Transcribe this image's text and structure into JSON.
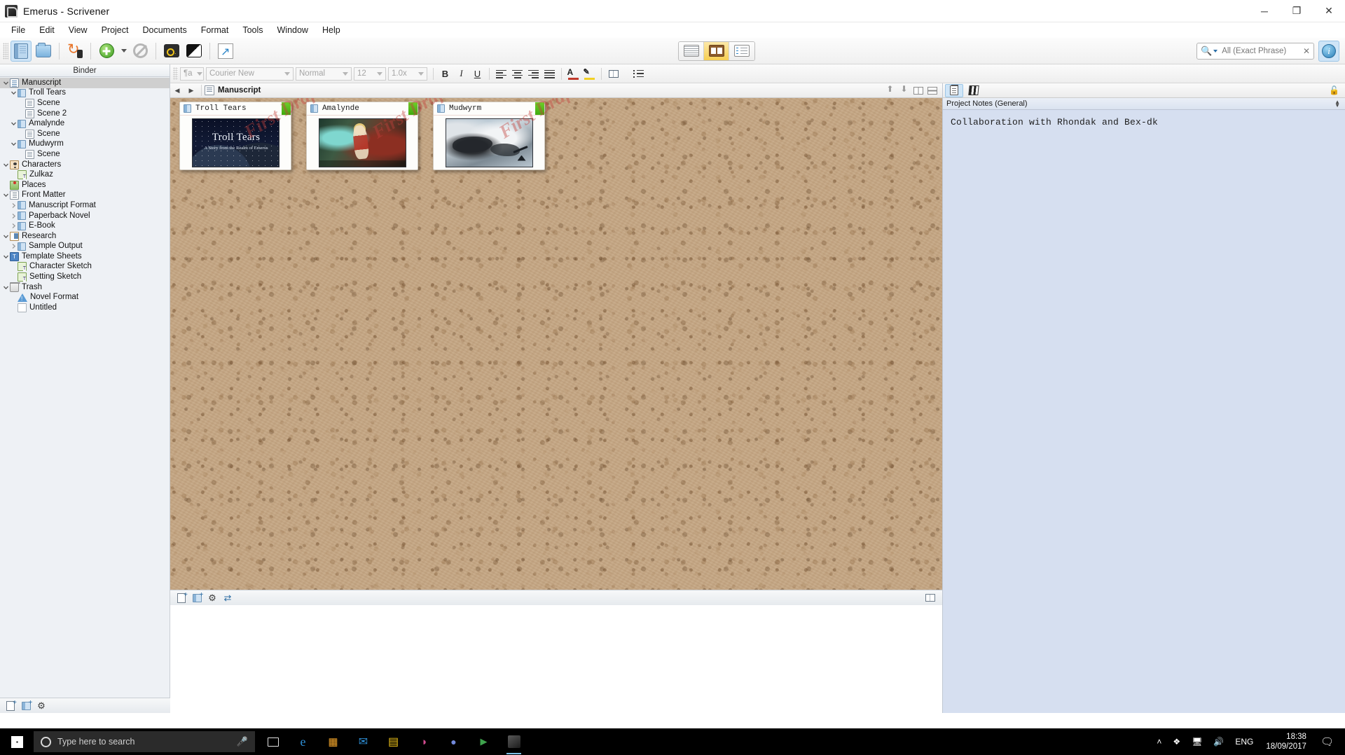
{
  "window": {
    "title": "Emerus - Scrivener",
    "app_icon": "scrivener-icon",
    "minimize": "─",
    "maximize": "❐",
    "close": "✕"
  },
  "menubar": {
    "items": [
      "File",
      "Edit",
      "View",
      "Project",
      "Documents",
      "Format",
      "Tools",
      "Window",
      "Help"
    ]
  },
  "toolbar": {
    "buttons": [
      {
        "name": "binder-toggle",
        "tip": "Binder",
        "active": true
      },
      {
        "name": "collections-toggle",
        "tip": "Collections",
        "active": false
      },
      {
        "name": "sync-mobile",
        "tip": "Sync with Mobile Devices",
        "active": false
      },
      {
        "name": "add-new",
        "tip": "Add",
        "active": false
      },
      {
        "name": "no-editing",
        "tip": "Lock in Place",
        "active": false
      },
      {
        "name": "keywords",
        "tip": "Keywords",
        "active": false
      },
      {
        "name": "split-screen",
        "tip": "Split Screen",
        "active": false
      },
      {
        "name": "compile",
        "tip": "Compile",
        "active": false
      }
    ],
    "view_modes": [
      {
        "name": "document-view",
        "label": "Document",
        "active": false
      },
      {
        "name": "corkboard-view",
        "label": "Corkboard",
        "active": true
      },
      {
        "name": "outliner-view",
        "label": "Outliner",
        "active": false
      }
    ],
    "search": {
      "value": "All (Exact Phrase)",
      "placeholder": "All (Exact Phrase)",
      "clear": "✕",
      "icon": "magnifier-icon"
    },
    "inspector_toggle": "i"
  },
  "formatbar": {
    "style": "¶a",
    "font": "Courier New",
    "paragraph": "Normal",
    "size": "12",
    "line_spacing": "1.0x",
    "bold": "B",
    "italic": "I",
    "underline": "U",
    "text_color": "A",
    "highlight": "✎"
  },
  "binder": {
    "header": "Binder",
    "items": [
      {
        "label": "Manuscript",
        "indent": 0,
        "twisty": "down",
        "icon": "manuscript-icon",
        "selected": true
      },
      {
        "label": "Troll Tears",
        "indent": 1,
        "twisty": "down",
        "icon": "folder-icon",
        "selected": false
      },
      {
        "label": "Scene",
        "indent": 2,
        "twisty": "none",
        "icon": "document-icon",
        "selected": false
      },
      {
        "label": "Scene 2",
        "indent": 2,
        "twisty": "none",
        "icon": "document-icon",
        "selected": false
      },
      {
        "label": "Amalynde",
        "indent": 1,
        "twisty": "down",
        "icon": "folder-icon",
        "selected": false
      },
      {
        "label": "Scene",
        "indent": 2,
        "twisty": "none",
        "icon": "document-icon",
        "selected": false
      },
      {
        "label": "Mudwyrm",
        "indent": 1,
        "twisty": "down",
        "icon": "folder-icon",
        "selected": false
      },
      {
        "label": "Scene",
        "indent": 2,
        "twisty": "none",
        "icon": "document-icon",
        "selected": false
      },
      {
        "label": "Characters",
        "indent": 0,
        "twisty": "down",
        "icon": "characters-icon",
        "selected": false
      },
      {
        "label": "Zulkaz",
        "indent": 1,
        "twisty": "none",
        "icon": "character-sheet-icon",
        "selected": false
      },
      {
        "label": "Places",
        "indent": 0,
        "twisty": "none",
        "icon": "places-icon",
        "selected": false
      },
      {
        "label": "Front Matter",
        "indent": 0,
        "twisty": "down",
        "icon": "front-matter-icon",
        "selected": false
      },
      {
        "label": "Manuscript Format",
        "indent": 1,
        "twisty": "right",
        "icon": "folder-icon",
        "selected": false
      },
      {
        "label": "Paperback Novel",
        "indent": 1,
        "twisty": "right",
        "icon": "folder-icon",
        "selected": false
      },
      {
        "label": "E-Book",
        "indent": 1,
        "twisty": "right",
        "icon": "folder-icon",
        "selected": false
      },
      {
        "label": "Research",
        "indent": 0,
        "twisty": "down",
        "icon": "research-icon",
        "selected": false
      },
      {
        "label": "Sample Output",
        "indent": 1,
        "twisty": "right",
        "icon": "folder-icon",
        "selected": false
      },
      {
        "label": "Template Sheets",
        "indent": 0,
        "twisty": "down",
        "icon": "template-icon",
        "selected": false
      },
      {
        "label": "Character Sketch",
        "indent": 1,
        "twisty": "none",
        "icon": "character-sheet-icon",
        "selected": false
      },
      {
        "label": "Setting Sketch",
        "indent": 1,
        "twisty": "none",
        "icon": "setting-sheet-icon",
        "selected": false
      },
      {
        "label": "Trash",
        "indent": 0,
        "twisty": "down",
        "icon": "trash-icon",
        "selected": false
      },
      {
        "label": "Novel Format",
        "indent": 1,
        "twisty": "none",
        "icon": "warning-icon",
        "selected": false
      },
      {
        "label": "Untitled",
        "indent": 1,
        "twisty": "none",
        "icon": "blank-doc-icon",
        "selected": false
      }
    ],
    "footer_buttons": [
      "new-document",
      "new-folder",
      "settings"
    ]
  },
  "editor": {
    "back_arrow": "◀",
    "forward_arrow": "▶",
    "title": "Manuscript",
    "header_buttons": [
      "go-up",
      "go-down",
      "vertical-split",
      "horizontal-split"
    ]
  },
  "corkboard": {
    "watermark_text": "First Draft",
    "cards": [
      {
        "title": "Troll Tears",
        "label_color": "#3ea80d",
        "image": {
          "type": "book-cover",
          "main_title": "Troll Tears",
          "subtitle": "A Story from the Realm of Emerus"
        }
      },
      {
        "title": "Amalynde",
        "label_color": "#3ea80d",
        "image": {
          "type": "character-art",
          "main_title": "",
          "subtitle": ""
        }
      },
      {
        "title": "Mudwyrm",
        "label_color": "#3ea80d",
        "image": {
          "type": "landscape-photo",
          "main_title": "",
          "subtitle": ""
        }
      }
    ],
    "footer_buttons": [
      "new-card",
      "new-folder-card",
      "card-settings",
      "swap-view"
    ],
    "footer_right": [
      "grid-size"
    ]
  },
  "inspector": {
    "tabs": [
      {
        "name": "notes-tab",
        "icon": "notepad-icon",
        "active": true
      },
      {
        "name": "references-tab",
        "icon": "books-icon",
        "active": false
      }
    ],
    "lock_icon": "unlocked-padlock-icon",
    "section_label": "Project Notes (General)",
    "notes_text": "Collaboration with Rhondak and Bex-dk"
  },
  "taskbar": {
    "start": "windows-logo",
    "search_placeholder": "Type here to search",
    "cortana_icon": "cortana-circle-icon",
    "mic_icon": "microphone-icon",
    "task_view_icon": "task-view-icon",
    "pinned": [
      {
        "name": "edge-icon",
        "glyph": "e",
        "color": "#2e8fd6",
        "running": false
      },
      {
        "name": "store-icon",
        "glyph": "▦",
        "color": "#f0a32a",
        "running": false
      },
      {
        "name": "mail-icon",
        "glyph": "✉",
        "color": "#2e8fd6",
        "running": false
      },
      {
        "name": "explorer-icon",
        "glyph": "▤",
        "color": "#f0c419",
        "running": false
      },
      {
        "name": "paint-icon",
        "glyph": "◑",
        "color": "#d14b8f",
        "running": false
      },
      {
        "name": "discord-icon",
        "glyph": "●",
        "color": "#7289da",
        "running": false
      },
      {
        "name": "media-icon",
        "glyph": "▶",
        "color": "#3fa34d",
        "running": false
      },
      {
        "name": "scrivener-icon",
        "glyph": "S",
        "color": "#b9b9b9",
        "running": true
      }
    ],
    "tray": {
      "expand_icon": "˄",
      "dropbox_icon": "dropbox-icon",
      "network_icon": "network-icon",
      "volume_icon": "🔊",
      "language": "ENG",
      "time": "18:38",
      "date": "18/09/2017",
      "notifications_icon": "action-center-icon"
    }
  }
}
